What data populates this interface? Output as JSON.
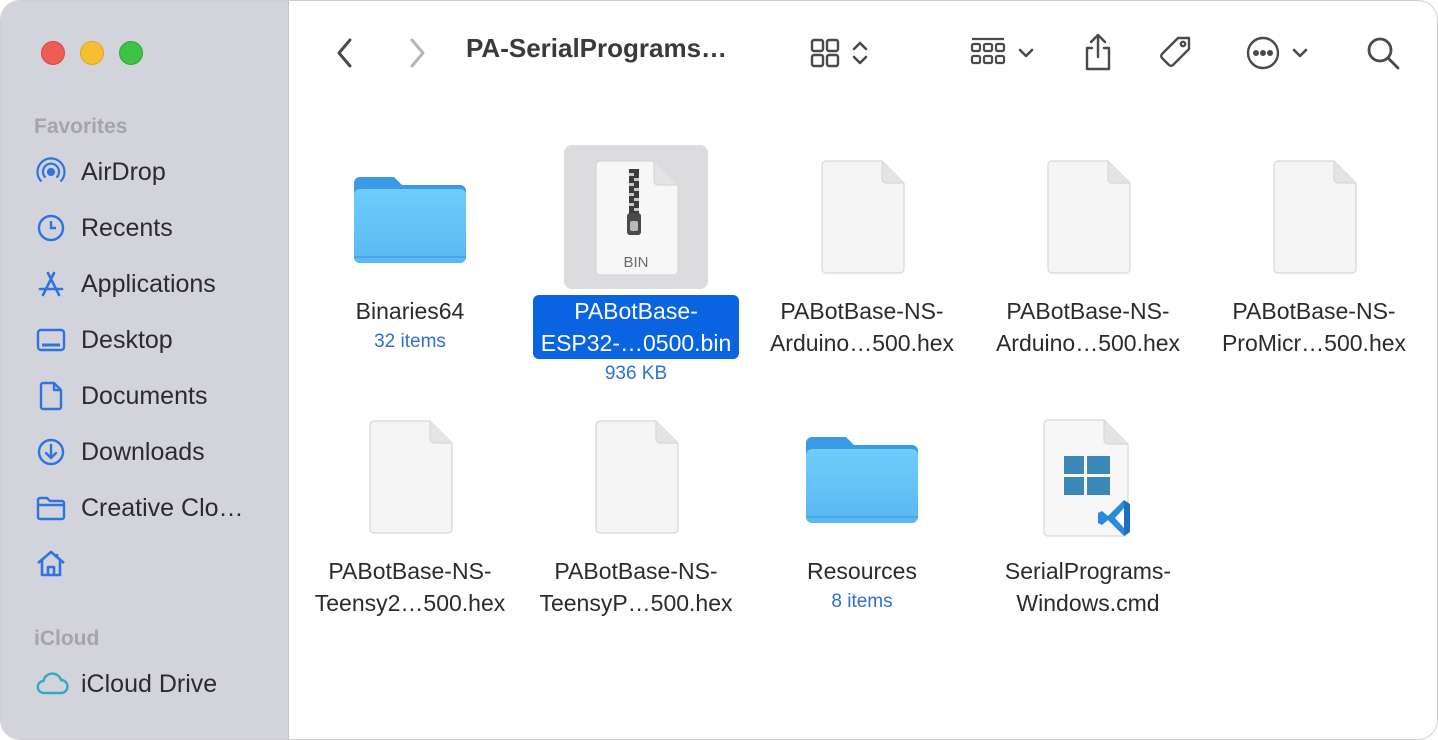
{
  "window": {
    "title": "PA-SerialPrograms…"
  },
  "sidebar": {
    "favorites_label": "Favorites",
    "icloud_label": "iCloud",
    "items": [
      {
        "label": "AirDrop",
        "icon": "airdrop-icon"
      },
      {
        "label": "Recents",
        "icon": "clock-icon"
      },
      {
        "label": "Applications",
        "icon": "applications-icon"
      },
      {
        "label": "Desktop",
        "icon": "desktop-icon"
      },
      {
        "label": "Documents",
        "icon": "document-icon"
      },
      {
        "label": "Downloads",
        "icon": "download-icon"
      },
      {
        "label": "Creative Clo…",
        "icon": "folder-icon"
      },
      {
        "label": "",
        "icon": "home-icon"
      }
    ],
    "icloud_items": [
      {
        "label": "iCloud Drive",
        "icon": "cloud-icon"
      }
    ]
  },
  "toolbar": {
    "icons": [
      "back-icon",
      "forward-icon",
      "grid-view-icon",
      "group-icon",
      "share-icon",
      "tag-icon",
      "more-icon",
      "search-icon"
    ]
  },
  "files": [
    {
      "name_line1": "Binaries64",
      "name_line2": "",
      "meta": "32 items",
      "kind": "folder",
      "selected": false
    },
    {
      "name_line1": "PABotBase-",
      "name_line2": "ESP32-…0500.bin",
      "meta": "936 KB",
      "kind": "bin",
      "badge": "BIN",
      "selected": true
    },
    {
      "name_line1": "PABotBase-NS-",
      "name_line2": "Arduino…500.hex",
      "meta": "",
      "kind": "doc",
      "selected": false
    },
    {
      "name_line1": "PABotBase-NS-",
      "name_line2": "Arduino…500.hex",
      "meta": "",
      "kind": "doc",
      "selected": false
    },
    {
      "name_line1": "PABotBase-NS-",
      "name_line2": "ProMicr…500.hex",
      "meta": "",
      "kind": "doc",
      "selected": false
    },
    {
      "name_line1": "PABotBase-NS-",
      "name_line2": "Teensy2…500.hex",
      "meta": "",
      "kind": "doc",
      "selected": false
    },
    {
      "name_line1": "PABotBase-NS-",
      "name_line2": "TeensyP…500.hex",
      "meta": "",
      "kind": "doc",
      "selected": false
    },
    {
      "name_line1": "Resources",
      "name_line2": "",
      "meta": "8 items",
      "kind": "folder",
      "selected": false
    },
    {
      "name_line1": "SerialPrograms-",
      "name_line2": "Windows.cmd",
      "meta": "",
      "kind": "cmd",
      "selected": false
    }
  ],
  "colors": {
    "accent": "#0a63e1",
    "folder": "#5cbef5",
    "sidebar_icon": "#2f73e0",
    "icloud_icon": "#34a8c7",
    "meta_text": "#2f6fd6"
  }
}
